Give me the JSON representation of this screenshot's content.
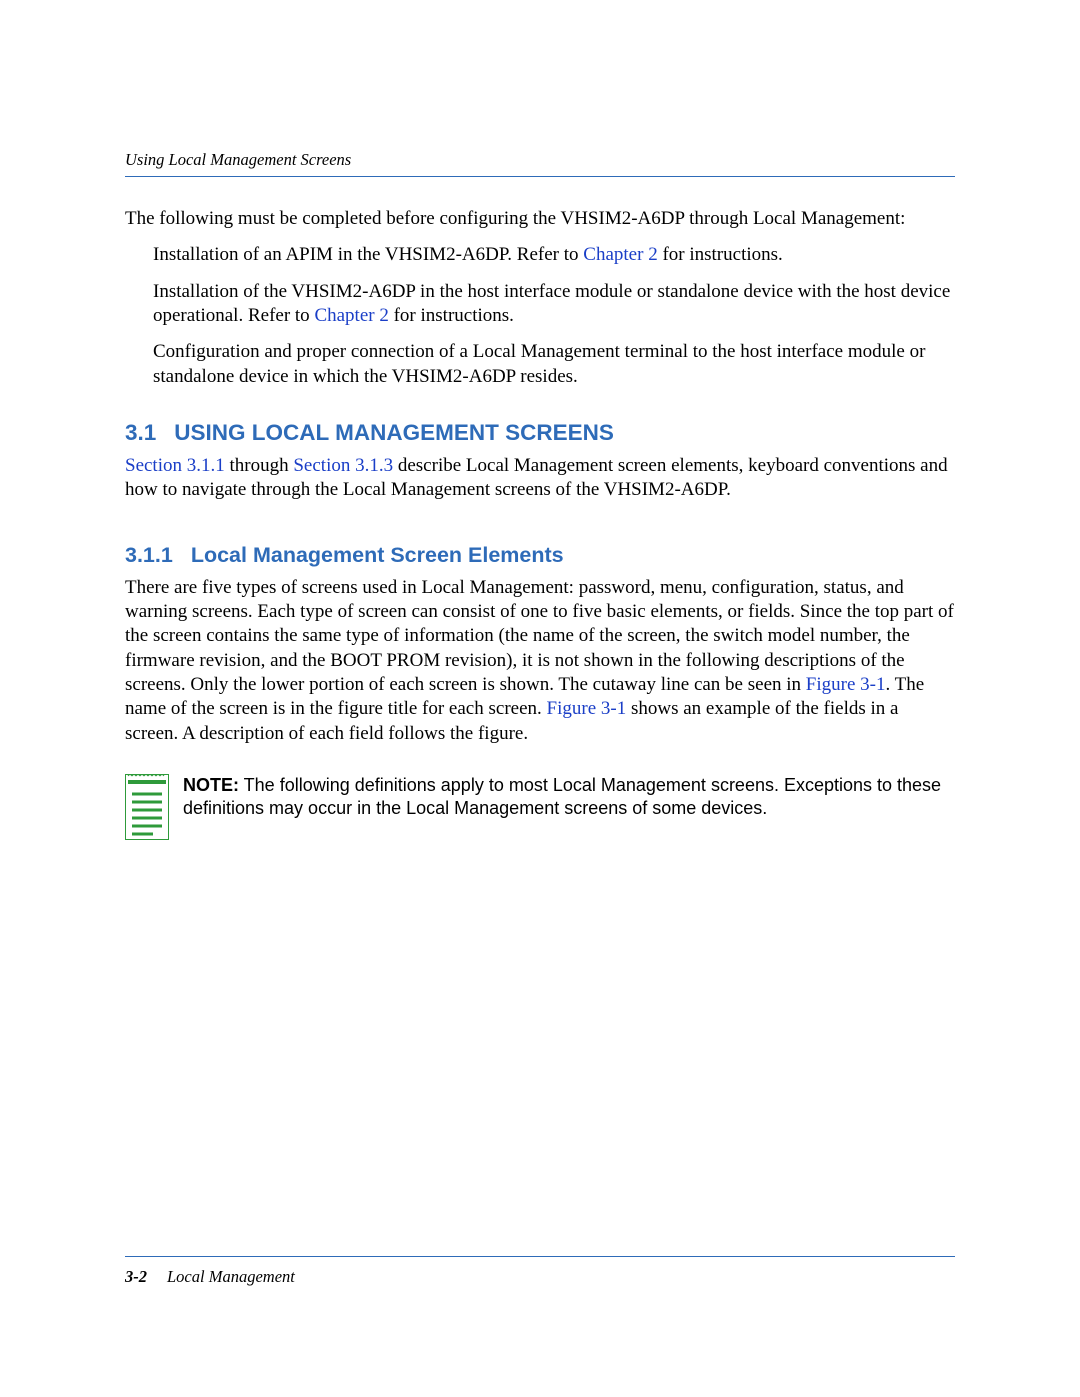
{
  "header": {
    "running_title": "Using Local Management Screens"
  },
  "intro": {
    "para1": "The following must be completed before configuring the VHSIM2-A6DP through Local Management:",
    "bullet1_a": "Installation of an APIM in the VHSIM2-A6DP. Refer to ",
    "bullet1_link": "Chapter 2",
    "bullet1_b": " for instructions.",
    "bullet2_a": "Installation of the VHSIM2-A6DP in the host interface module or standalone device with the host device operational. Refer to ",
    "bullet2_link": "Chapter 2",
    "bullet2_b": " for instructions.",
    "bullet3": "Configuration and proper connection of a Local Management terminal to the host interface module or standalone device in which the VHSIM2-A6DP resides."
  },
  "section31": {
    "number": "3.1",
    "title": "USING LOCAL MANAGEMENT SCREENS",
    "link1": "Section 3.1.1",
    "mid": " through ",
    "link2": "Section 3.1.3",
    "rest": " describe Local Management screen elements, keyboard conventions and how to navigate through the Local Management screens of the VHSIM2-A6DP."
  },
  "section311": {
    "number": "3.1.1",
    "title": "Local Management Screen Elements",
    "para_a": "There are five types of screens used in Local Management: password, menu, configuration, status, and warning screens. Each type of screen can consist of one to five basic elements, or fields. Since the top part of the screen contains the same type of information (the name of the screen, the switch model number, the firmware revision, and the BOOT PROM revision), it is not shown in the following descriptions of the screens. Only the lower portion of each screen is shown. The cutaway line can be seen in ",
    "fig1a": "Figure 3-1",
    "para_b": ". The name of the screen is in the figure title for each screen. ",
    "fig1b": "Figure 3-1",
    "para_c": " shows an example of the fields in a screen. A description of each field follows the figure."
  },
  "note": {
    "label": "NOTE:",
    "text": " The following definitions apply to most Local Management screens. Exceptions to these definitions may occur in the Local Management screens of some devices."
  },
  "footer": {
    "page": "3-2",
    "title": "Local Management"
  }
}
